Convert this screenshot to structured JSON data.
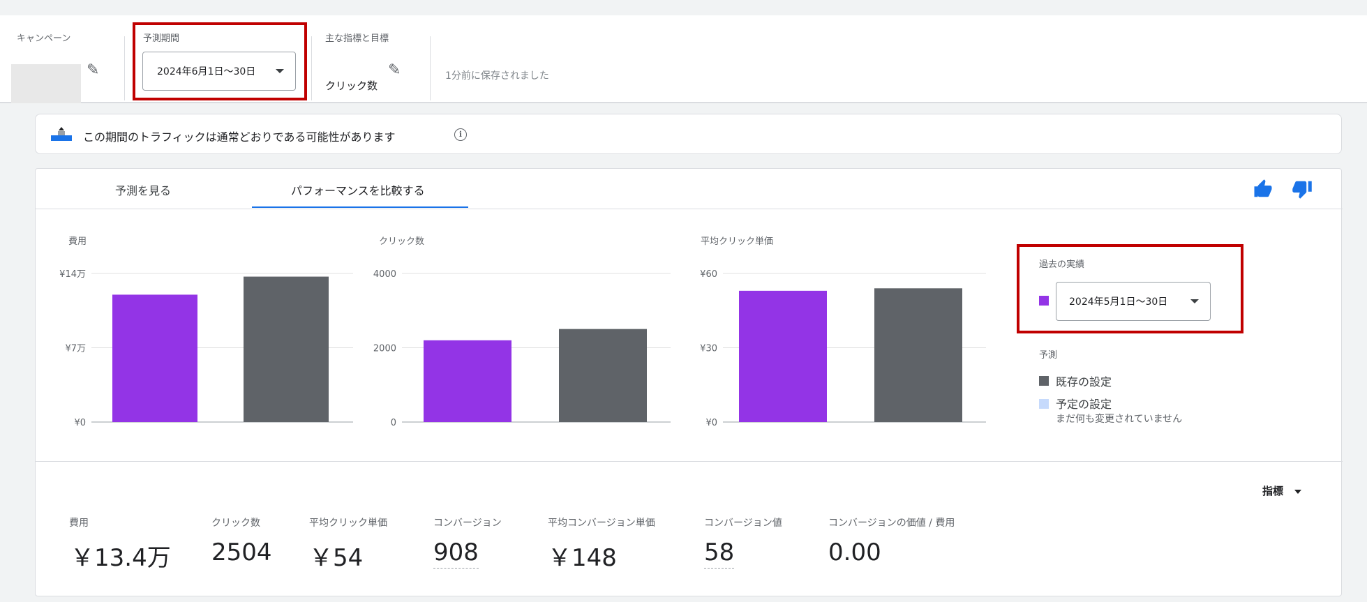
{
  "topbar": {
    "campaign_label": "キャンペーン",
    "period_label": "予測期間",
    "period_value": "2024年6月1日～30日",
    "metric_label": "主な指標と目標",
    "metric_value": "クリック数",
    "saved_text": "1分前に保存されました"
  },
  "notice": {
    "text": "この期間のトラフィックは通常どおりである可能性があります",
    "info_icon": "info-icon"
  },
  "tabs": [
    {
      "label": "予測を見る",
      "active": false
    },
    {
      "label": "パフォーマンスを比較する",
      "active": true
    }
  ],
  "feedback": {
    "thumbs_up": "thumb-up-icon",
    "thumbs_down": "thumb-down-icon"
  },
  "colors": {
    "past": "#9334e6",
    "existing": "#5f6368",
    "planned": "#c6dafc",
    "highlight": "#c00000",
    "tab": "#1a73e8"
  },
  "chart_data": [
    {
      "type": "bar",
      "title": "費用",
      "categories": [
        "過去の実績",
        "既存の設定"
      ],
      "values": [
        120000,
        137000
      ],
      "yticks": [
        "¥0",
        "¥7万",
        "¥14万"
      ],
      "ylim": [
        0,
        140000
      ]
    },
    {
      "type": "bar",
      "title": "クリック数",
      "categories": [
        "過去の実績",
        "既存の設定"
      ],
      "values": [
        2200,
        2504
      ],
      "yticks": [
        "0",
        "2000",
        "4000"
      ],
      "ylim": [
        0,
        4000
      ]
    },
    {
      "type": "bar",
      "title": "平均クリック単価",
      "categories": [
        "過去の実績",
        "既存の設定"
      ],
      "values": [
        53,
        54
      ],
      "yticks": [
        "¥0",
        "¥30",
        "¥60"
      ],
      "ylim": [
        0,
        60
      ]
    }
  ],
  "legend": {
    "past_label": "過去の実績",
    "past_period": "2024年5月1日～30日",
    "forecast_label": "予測",
    "existing_label": "既存の設定",
    "planned_label": "予定の設定",
    "planned_sub": "まだ何も変更されていません"
  },
  "metrics_button": "指標",
  "stats": [
    {
      "label": "費用",
      "value": "￥13.4万"
    },
    {
      "label": "クリック数",
      "value": "2504"
    },
    {
      "label": "平均クリック単価",
      "value": "￥54"
    },
    {
      "label": "コンバージョン",
      "value": "908"
    },
    {
      "label": "平均コンバージョン単価",
      "value": "￥148"
    },
    {
      "label": "コンバージョン値",
      "value": "58"
    },
    {
      "label": "コンバージョンの価値 / 費用",
      "value": "0.00"
    }
  ]
}
